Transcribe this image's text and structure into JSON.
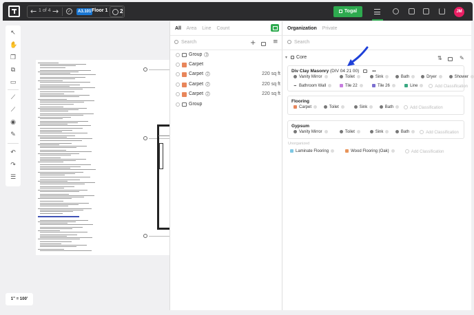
{
  "toolbar": {
    "page_counter": "1 of 4",
    "sheet_badge": "A3.101",
    "floor_label": "Floor 1",
    "user_count": "2",
    "togal_label": "Togal",
    "avatar_initials": "JM",
    "accent": "#2eaa4f"
  },
  "scale_label": "1\" = 100'",
  "left_panel": {
    "tabs": [
      "All",
      "Area",
      "Line",
      "Count"
    ],
    "search_placeholder": "Search",
    "rows": [
      {
        "type": "group",
        "label": "Group",
        "badge": "3",
        "area": ""
      },
      {
        "type": "item",
        "label": "Carpet",
        "badge": "",
        "area": ""
      },
      {
        "type": "item",
        "label": "Carpet",
        "badge": "2",
        "area": "220 sq ft"
      },
      {
        "type": "item",
        "label": "Carpet",
        "badge": "2",
        "area": "220 sq ft"
      },
      {
        "type": "item",
        "label": "Carpet",
        "badge": "2",
        "area": "220 sq ft"
      },
      {
        "type": "group",
        "label": "Group",
        "badge": "",
        "area": ""
      }
    ]
  },
  "right_panel": {
    "tabs": [
      "Organization",
      "Private"
    ],
    "search_placeholder": "Search",
    "core_label": "Core",
    "add_classification": "Add Classification",
    "unorganized_label": "Unorganized",
    "cards": [
      {
        "title": "Div Clay Masonry",
        "code": "(DIV 04 21 00)",
        "rows": [
          [
            "Vanity Mirror",
            "Toilet",
            "Sink",
            "Bath",
            "Dryer",
            "Shower"
          ],
          [
            "Bathroom Wall",
            "Tile 22",
            "Tile 26",
            "Line"
          ]
        ]
      },
      {
        "title": "Flooring",
        "code": "",
        "rows": [
          [
            "Carpet",
            "Toilet",
            "Sink",
            "Bath"
          ]
        ]
      },
      {
        "title": "Gypsum",
        "code": "",
        "rows": [
          [
            "Vanity Mirror",
            "Toilet",
            "Sink",
            "Bath"
          ]
        ]
      }
    ],
    "unorganized": [
      "Laminate Flooring",
      "Wood Flooring (Oak)"
    ]
  }
}
